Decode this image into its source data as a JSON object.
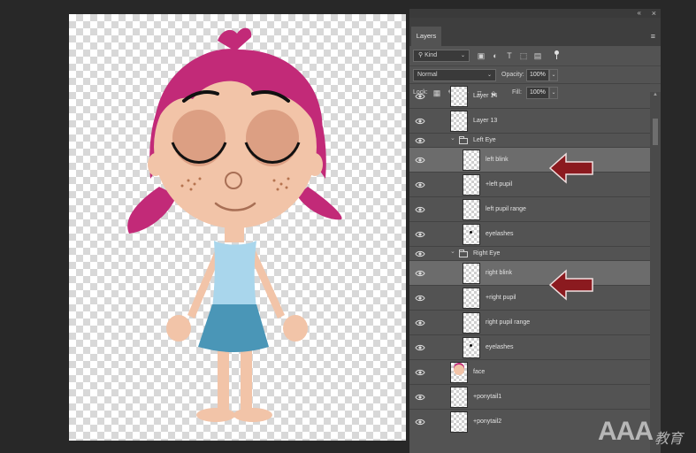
{
  "panel": {
    "tab_label": "Layers",
    "collapse_glyph": "«",
    "close_glyph": "×",
    "menu_glyph": "≡"
  },
  "filter": {
    "kind_label": "Kind",
    "kind_chevron": "⌄"
  },
  "blend": {
    "mode": "Normal",
    "mode_chevron": "⌄",
    "opacity_label": "Opacity:",
    "opacity_value": "100%",
    "opacity_chevron": "⌄"
  },
  "lock": {
    "label": "Lock:",
    "fill_label": "Fill:",
    "fill_value": "100%",
    "fill_chevron": "⌄"
  },
  "layers": [
    {
      "name": "Layer 14",
      "type": "layer",
      "indent": 0,
      "selected": false,
      "thumb": "blank"
    },
    {
      "name": "Layer 13",
      "type": "layer",
      "indent": 0,
      "selected": false,
      "thumb": "blank"
    },
    {
      "name": "Left Eye",
      "type": "group",
      "indent": 0,
      "selected": false
    },
    {
      "name": "left blink",
      "type": "layer",
      "indent": 1,
      "selected": true,
      "thumb": "blank"
    },
    {
      "name": "+left pupil",
      "type": "layer",
      "indent": 1,
      "selected": false,
      "thumb": "blank"
    },
    {
      "name": "left pupil range",
      "type": "layer",
      "indent": 1,
      "selected": false,
      "thumb": "blank"
    },
    {
      "name": "eyelashes",
      "type": "layer",
      "indent": 1,
      "selected": false,
      "thumb": "dot"
    },
    {
      "name": "Right Eye",
      "type": "group",
      "indent": 0,
      "selected": false
    },
    {
      "name": "right blink",
      "type": "layer",
      "indent": 1,
      "selected": true,
      "thumb": "blank"
    },
    {
      "name": "+right pupil",
      "type": "layer",
      "indent": 1,
      "selected": false,
      "thumb": "blank"
    },
    {
      "name": "right pupil range",
      "type": "layer",
      "indent": 1,
      "selected": false,
      "thumb": "blank"
    },
    {
      "name": "eyelashes",
      "type": "layer",
      "indent": 1,
      "selected": false,
      "thumb": "dot"
    },
    {
      "name": "face",
      "type": "layer",
      "indent": 0,
      "selected": false,
      "thumb": "face"
    },
    {
      "name": "+ponytail1",
      "type": "layer",
      "indent": 0,
      "selected": false,
      "thumb": "blank"
    },
    {
      "name": "+ponytail2",
      "type": "layer",
      "indent": 0,
      "selected": false,
      "thumb": "blank"
    }
  ],
  "icons": {
    "visibility": "eye-icon",
    "group": "folder-icon",
    "annotation": "red-arrow-icon"
  },
  "colors": {
    "panel_bg": "#535353",
    "selected_row": "#6c6c6c",
    "arrow_red": "#8b1a1f",
    "hair": "#c22a78",
    "skin": "#f2c4a8",
    "top": "#a9d6ec",
    "skirt": "#4a96b7"
  },
  "watermark": {
    "latin": "AAA",
    "chinese": "教育"
  }
}
